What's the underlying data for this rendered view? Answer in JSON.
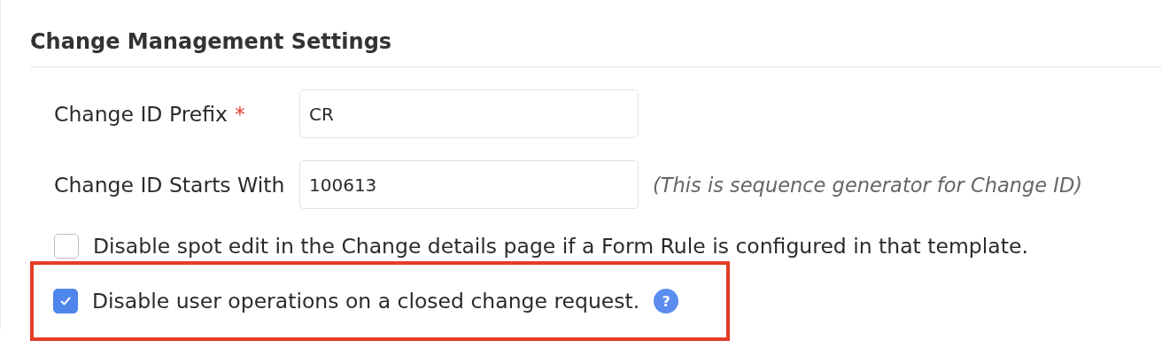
{
  "section": {
    "title": "Change Management Settings"
  },
  "fields": [
    {
      "label": "Change ID Prefix",
      "required_mark": "*",
      "value": "CR"
    },
    {
      "label": "Change ID Starts With",
      "value": "100613",
      "hint": "(This is sequence generator for Change ID)"
    }
  ],
  "options": [
    {
      "label": "Disable spot edit in the Change details page if a Form Rule is configured in that template.",
      "checked": false,
      "highlighted": false
    },
    {
      "label": "Disable user operations on a closed change request.",
      "checked": true,
      "highlighted": true,
      "help": "?"
    }
  ]
}
